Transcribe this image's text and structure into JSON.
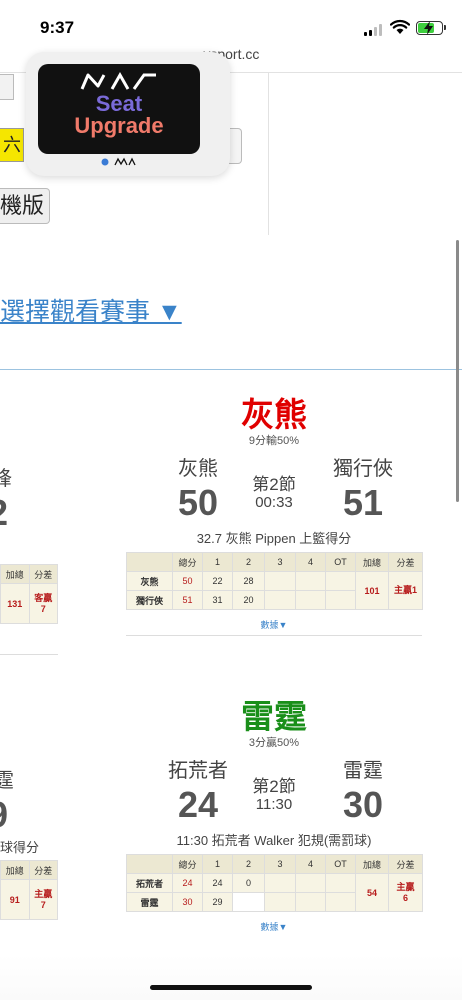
{
  "status_bar": {
    "time": "9:37"
  },
  "browser": {
    "url_prefix": "",
    "url_visible": "sport.cc",
    "url_glyph": "y"
  },
  "ad": {
    "brand": "KIA",
    "line1": "Seat",
    "line2": "Upgrade"
  },
  "left_remnants": {
    "yellow_char": "六",
    "mobile_label": "機版"
  },
  "select_game_link": "選擇觀看賽事 ▼",
  "colors": {
    "link": "#3a83c9",
    "red_team": "#e00000",
    "green_team": "#1a8f1a",
    "score_red": "#b71c1c"
  },
  "partial_left": [
    {
      "name_tail": "锋",
      "score_tail": "2",
      "headers": [
        "加總",
        "分差"
      ],
      "sum": "131",
      "diff": "客贏\n7"
    },
    {
      "name_tail": "霆",
      "score_tail": "9",
      "event_tail": "球得分",
      "headers": [
        "加總",
        "分差"
      ],
      "sum": "91",
      "diff": "主贏\n7"
    }
  ],
  "games": [
    {
      "title": "灰熊",
      "title_color": "#e00000",
      "subtitle": "9分輸50%",
      "home_name": "灰熊",
      "home_score": "50",
      "away_name": "獨行俠",
      "away_score": "51",
      "quarter": "第2節",
      "clock": "00:33",
      "event": "32.7 灰熊 Pippen 上籃得分",
      "headers": [
        "",
        "總分",
        "1",
        "2",
        "3",
        "4",
        "OT",
        "加總",
        "分差"
      ],
      "rows": [
        {
          "team": "灰熊",
          "total": "50",
          "q": [
            "22",
            "28",
            "",
            "",
            ""
          ]
        },
        {
          "team": "獨行俠",
          "total": "51",
          "q": [
            "31",
            "20",
            "",
            "",
            ""
          ]
        }
      ],
      "sum": "101",
      "diff": "主贏1",
      "more": "數據▼"
    },
    {
      "title": "雷霆",
      "title_color": "#1a8f1a",
      "subtitle": "3分贏50%",
      "home_name": "拓荒者",
      "home_score": "24",
      "away_name": "雷霆",
      "away_score": "30",
      "quarter": "第2節",
      "clock": "11:30",
      "event": "11:30 拓荒者 Walker 犯規(需罰球)",
      "headers": [
        "",
        "總分",
        "1",
        "2",
        "3",
        "4",
        "OT",
        "加總",
        "分差"
      ],
      "rows": [
        {
          "team": "拓荒者",
          "total": "24",
          "q": [
            "24",
            "0",
            "",
            "",
            ""
          ]
        },
        {
          "team": "雷霆",
          "total": "30",
          "q": [
            "29",
            "",
            "",
            "",
            ""
          ]
        }
      ],
      "sum": "54",
      "diff": "主贏\n6",
      "more": "數據▼"
    }
  ]
}
